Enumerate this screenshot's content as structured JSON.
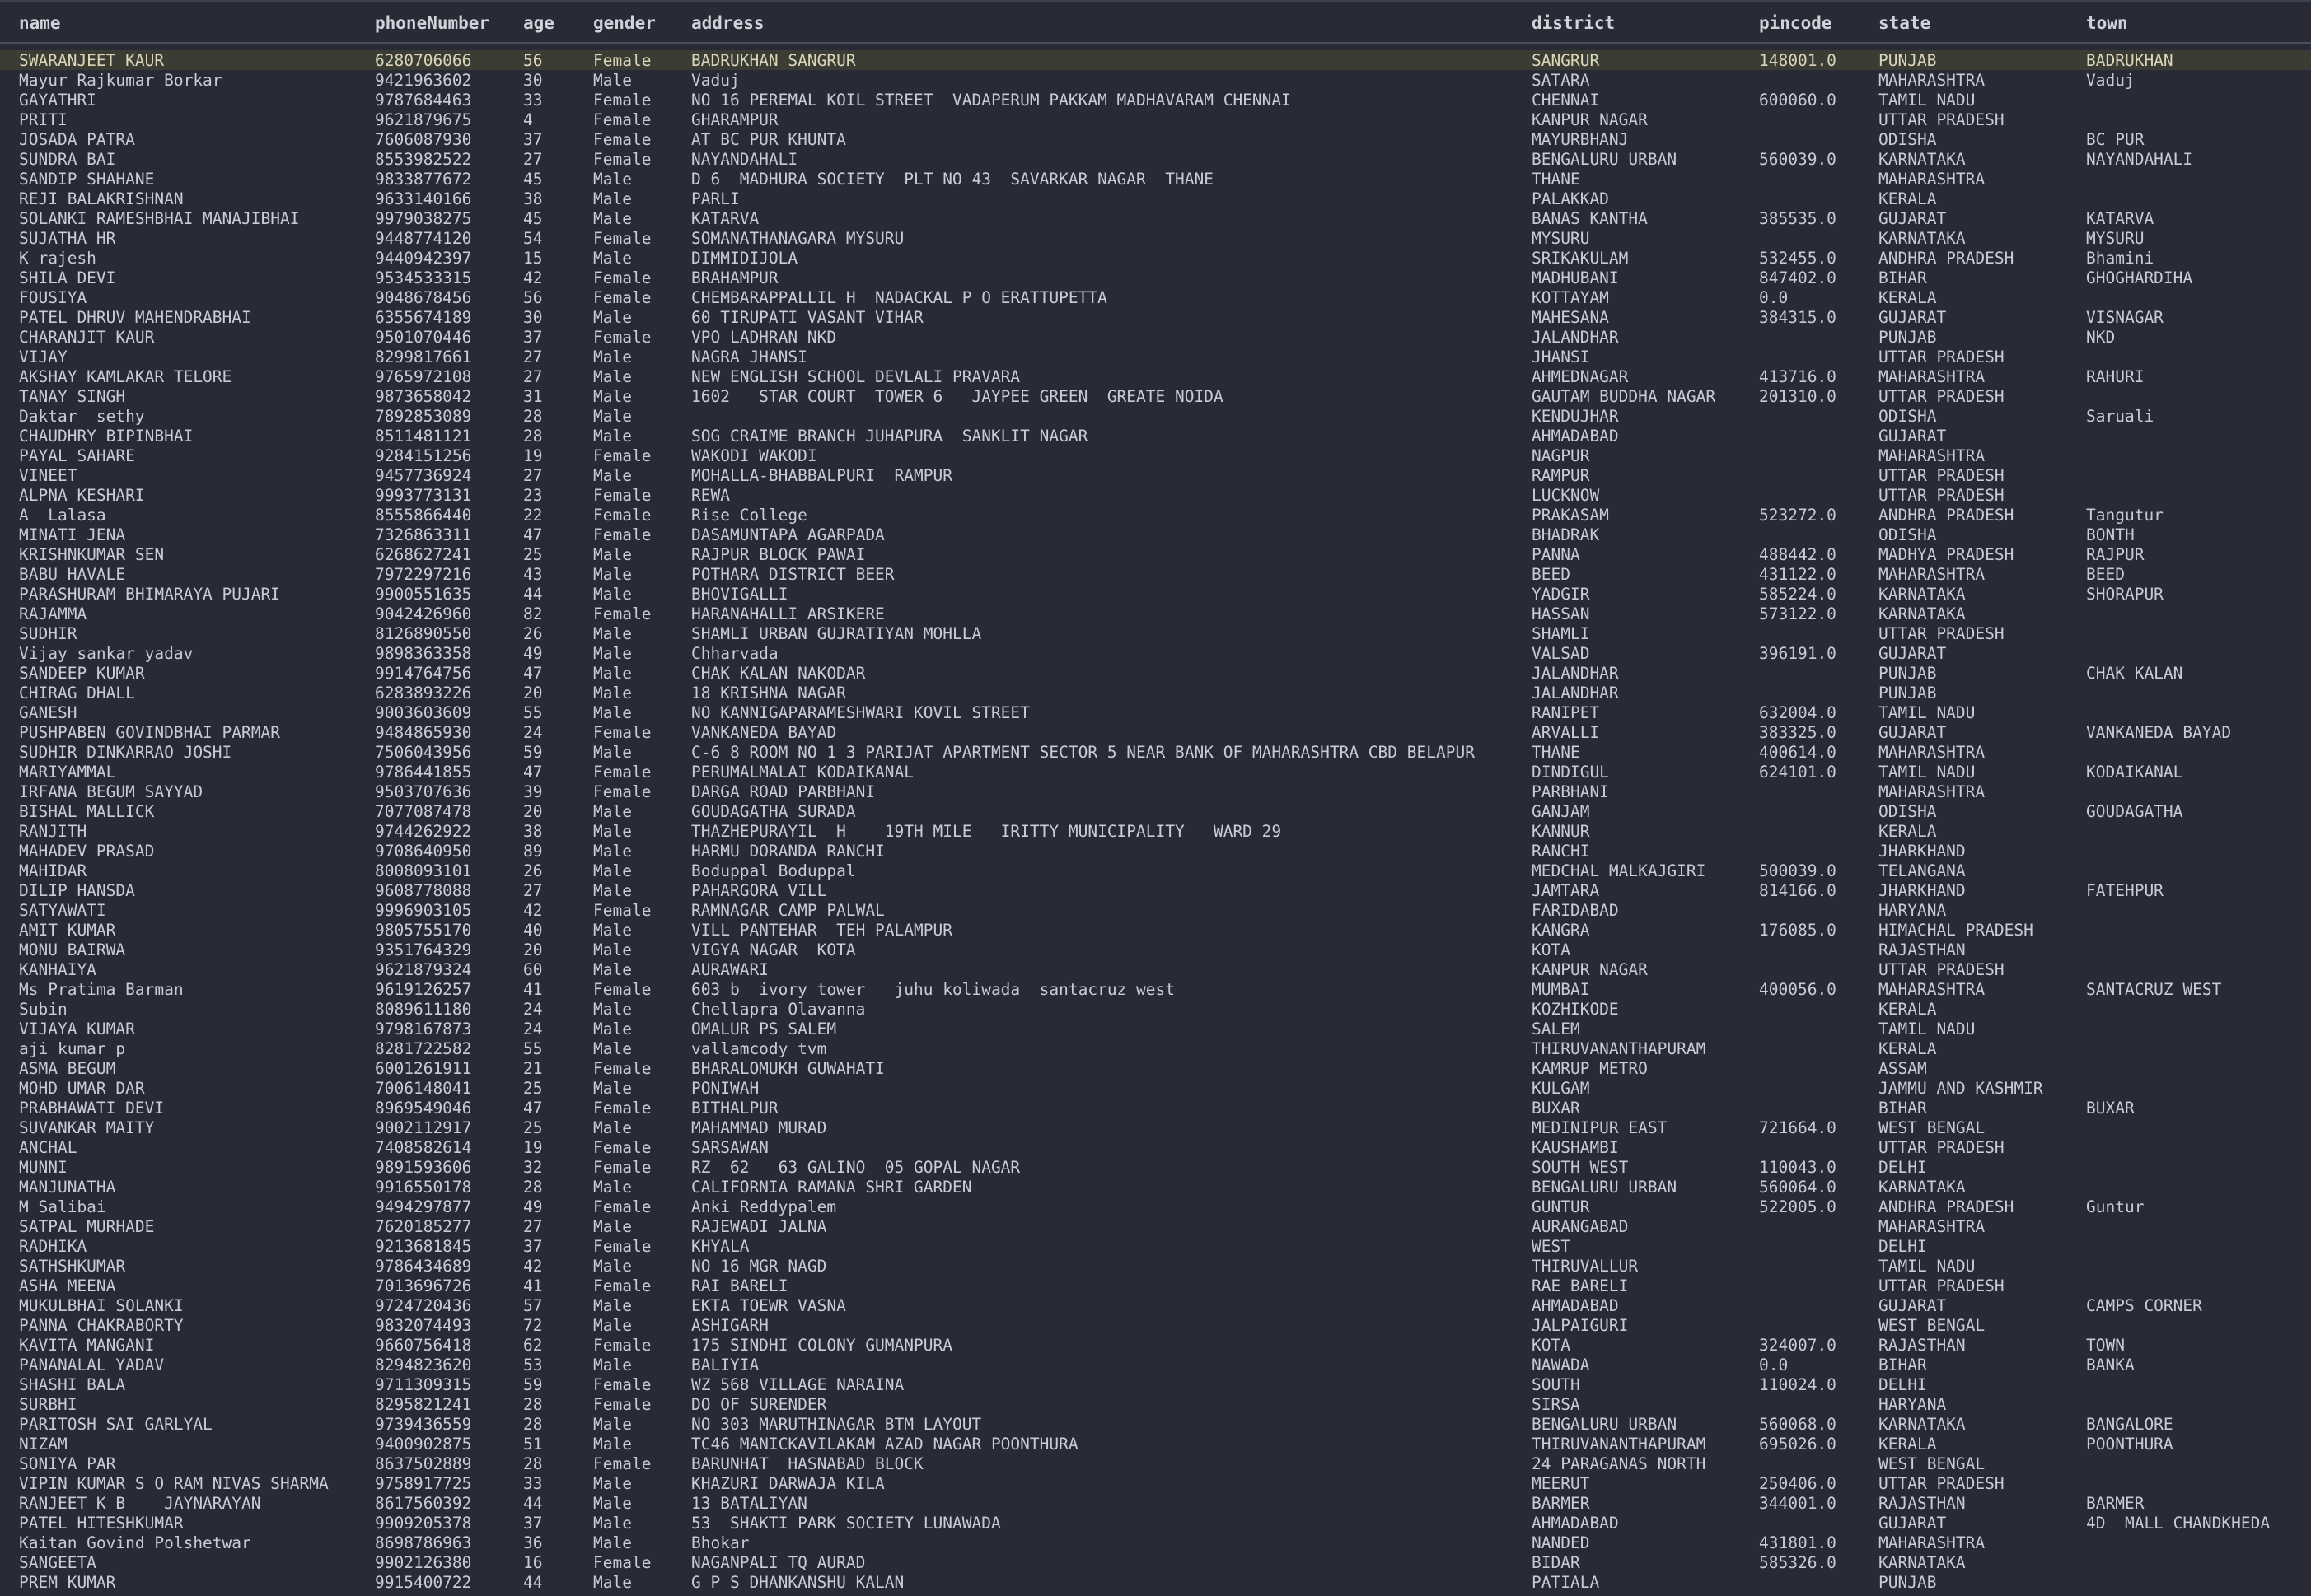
{
  "columns": [
    "name",
    "phoneNumber",
    "age",
    "gender",
    "address",
    "district",
    "pincode",
    "state",
    "town"
  ],
  "selected_row": 0,
  "rows": [
    [
      "SWARANJEET KAUR",
      "6280706066",
      "56",
      "Female",
      "BADRUKHAN SANGRUR",
      "SANGRUR",
      "148001.0",
      "PUNJAB",
      "BADRUKHAN"
    ],
    [
      "Mayur Rajkumar Borkar",
      "9421963602",
      "30",
      "Male",
      "Vaduj",
      "SATARA",
      "",
      "MAHARASHTRA",
      "Vaduj"
    ],
    [
      "GAYATHRI",
      "9787684463",
      "33",
      "Female",
      "NO 16 PEREMAL KOIL STREET  VADAPERUM PAKKAM MADHAVARAM CHENNAI",
      "CHENNAI",
      "600060.0",
      "TAMIL NADU",
      ""
    ],
    [
      "PRITI",
      "9621879675",
      "4",
      "Female",
      "GHARAMPUR",
      "KANPUR NAGAR",
      "",
      "UTTAR PRADESH",
      ""
    ],
    [
      "JOSADA PATRA",
      "7606087930",
      "37",
      "Female",
      "AT BC PUR KHUNTA",
      "MAYURBHANJ",
      "",
      "ODISHA",
      "BC PUR"
    ],
    [
      "SUNDRA BAI",
      "8553982522",
      "27",
      "Female",
      "NAYANDAHALI",
      "BENGALURU URBAN",
      "560039.0",
      "KARNATAKA",
      "NAYANDAHALI"
    ],
    [
      "SANDIP SHAHANE",
      "9833877672",
      "45",
      "Male",
      "D 6  MADHURA SOCIETY  PLT NO 43  SAVARKAR NAGAR  THANE",
      "THANE",
      "",
      "MAHARASHTRA",
      ""
    ],
    [
      "REJI BALAKRISHNAN",
      "9633140166",
      "38",
      "Male",
      "PARLI",
      "PALAKKAD",
      "",
      "KERALA",
      ""
    ],
    [
      "SOLANKI RAMESHBHAI MANAJIBHAI",
      "9979038275",
      "45",
      "Male",
      "KATARVA",
      "BANAS KANTHA",
      "385535.0",
      "GUJARAT",
      "KATARVA"
    ],
    [
      "SUJATHA HR",
      "9448774120",
      "54",
      "Female",
      "SOMANATHANAGARA MYSURU",
      "MYSURU",
      "",
      "KARNATAKA",
      "MYSURU"
    ],
    [
      "K rajesh",
      "9440942397",
      "15",
      "Male",
      "DIMMIDIJOLA",
      "SRIKAKULAM",
      "532455.0",
      "ANDHRA PRADESH",
      "Bhamini"
    ],
    [
      "SHILA DEVI",
      "9534533315",
      "42",
      "Female",
      "BRAHAMPUR",
      "MADHUBANI",
      "847402.0",
      "BIHAR",
      "GHOGHARDIHA"
    ],
    [
      "FOUSIYA",
      "9048678456",
      "56",
      "Female",
      "CHEMBARAPPALLIL H  NADACKAL P O ERATTUPETTA",
      "KOTTAYAM",
      "0.0",
      "KERALA",
      ""
    ],
    [
      "PATEL DHRUV MAHENDRABHAI",
      "6355674189",
      "30",
      "Male",
      "60 TIRUPATI VASANT VIHAR",
      "MAHESANA",
      "384315.0",
      "GUJARAT",
      "VISNAGAR"
    ],
    [
      "CHARANJIT KAUR",
      "9501070446",
      "37",
      "Female",
      "VPO LADHRAN NKD",
      "JALANDHAR",
      "",
      "PUNJAB",
      "NKD"
    ],
    [
      "VIJAY",
      "8299817661",
      "27",
      "Male",
      "NAGRA JHANSI",
      "JHANSI",
      "",
      "UTTAR PRADESH",
      ""
    ],
    [
      "AKSHAY KAMLAKAR TELORE",
      "9765972108",
      "27",
      "Male",
      "NEW ENGLISH SCHOOL DEVLALI PRAVARA",
      "AHMEDNAGAR",
      "413716.0",
      "MAHARASHTRA",
      "RAHURI"
    ],
    [
      "TANAY SINGH",
      "9873658042",
      "31",
      "Male",
      "1602   STAR COURT  TOWER 6   JAYPEE GREEN  GREATE NOIDA",
      "GAUTAM BUDDHA NAGAR",
      "201310.0",
      "UTTAR PRADESH",
      ""
    ],
    [
      "Daktar  sethy",
      "7892853089",
      "28",
      "Male",
      "",
      "KENDUJHAR",
      "",
      "ODISHA",
      "Saruali"
    ],
    [
      "CHAUDHRY BIPINBHAI",
      "8511481121",
      "28",
      "Male",
      "SOG CRAIME BRANCH JUHAPURA  SANKLIT NAGAR",
      "AHMADABAD",
      "",
      "GUJARAT",
      ""
    ],
    [
      "PAYAL SAHARE",
      "9284151256",
      "19",
      "Female",
      "WAKODI WAKODI",
      "NAGPUR",
      "",
      "MAHARASHTRA",
      ""
    ],
    [
      "VINEET",
      "9457736924",
      "27",
      "Male",
      "MOHALLA-BHABBALPURI  RAMPUR",
      "RAMPUR",
      "",
      "UTTAR PRADESH",
      ""
    ],
    [
      "ALPNA KESHARI",
      "9993773131",
      "23",
      "Female",
      "REWA",
      "LUCKNOW",
      "",
      "UTTAR PRADESH",
      ""
    ],
    [
      "A  Lalasa",
      "8555866440",
      "22",
      "Female",
      "Rise College",
      "PRAKASAM",
      "523272.0",
      "ANDHRA PRADESH",
      "Tangutur"
    ],
    [
      "MINATI JENA",
      "7326863311",
      "47",
      "Female",
      "DASAMUNTAPA AGARPADA",
      "BHADRAK",
      "",
      "ODISHA",
      "BONTH"
    ],
    [
      "KRISHNKUMAR SEN",
      "6268627241",
      "25",
      "Male",
      "RAJPUR BLOCK PAWAI",
      "PANNA",
      "488442.0",
      "MADHYA PRADESH",
      "RAJPUR"
    ],
    [
      "BABU HAVALE",
      "7972297216",
      "43",
      "Male",
      "POTHARA DISTRICT BEER",
      "BEED",
      "431122.0",
      "MAHARASHTRA",
      "BEED"
    ],
    [
      "PARASHURAM BHIMARAYA PUJARI",
      "9900551635",
      "44",
      "Male",
      "BHOVIGALLI",
      "YADGIR",
      "585224.0",
      "KARNATAKA",
      "SHORAPUR"
    ],
    [
      "RAJAMMA",
      "9042426960",
      "82",
      "Female",
      "HARANAHALLI ARSIKERE",
      "HASSAN",
      "573122.0",
      "KARNATAKA",
      ""
    ],
    [
      "SUDHIR",
      "8126890550",
      "26",
      "Male",
      "SHAMLI URBAN GUJRATIYAN MOHLLA",
      "SHAMLI",
      "",
      "UTTAR PRADESH",
      ""
    ],
    [
      "Vijay sankar yadav",
      "9898363358",
      "49",
      "Male",
      "Chharvada",
      "VALSAD",
      "396191.0",
      "GUJARAT",
      ""
    ],
    [
      "SANDEEP KUMAR",
      "9914764756",
      "47",
      "Male",
      "CHAK KALAN NAKODAR",
      "JALANDHAR",
      "",
      "PUNJAB",
      "CHAK KALAN"
    ],
    [
      "CHIRAG DHALL",
      "6283893226",
      "20",
      "Male",
      "18 KRISHNA NAGAR",
      "JALANDHAR",
      "",
      "PUNJAB",
      ""
    ],
    [
      "GANESH",
      "9003603609",
      "55",
      "Male",
      "NO KANNIGAPARAMESHWARI KOVIL STREET",
      "RANIPET",
      "632004.0",
      "TAMIL NADU",
      ""
    ],
    [
      "PUSHPABEN GOVINDBHAI PARMAR",
      "9484865930",
      "24",
      "Female",
      "VANKANEDA BAYAD",
      "ARVALLI",
      "383325.0",
      "GUJARAT",
      "VANKANEDA BAYAD"
    ],
    [
      "SUDHIR DINKARRAO JOSHI",
      "7506043956",
      "59",
      "Male",
      "C-6 8 ROOM NO 1 3 PARIJAT APARTMENT SECTOR 5 NEAR BANK OF MAHARASHTRA CBD BELAPUR",
      "THANE",
      "400614.0",
      "MAHARASHTRA",
      ""
    ],
    [
      "MARIYAMMAL",
      "9786441855",
      "47",
      "Female",
      "PERUMALMALAI KODAIKANAL",
      "DINDIGUL",
      "624101.0",
      "TAMIL NADU",
      "KODAIKANAL"
    ],
    [
      "IRFANA BEGUM SAYYAD",
      "9503707636",
      "39",
      "Female",
      "DARGA ROAD PARBHANI",
      "PARBHANI",
      "",
      "MAHARASHTRA",
      ""
    ],
    [
      "BISHAL MALLICK",
      "7077087478",
      "20",
      "Male",
      "GOUDAGATHA SURADA",
      "GANJAM",
      "",
      "ODISHA",
      "GOUDAGATHA"
    ],
    [
      "RANJITH",
      "9744262922",
      "38",
      "Male",
      "THAZHEPURAYIL  H    19TH MILE   IRITTY MUNICIPALITY   WARD 29",
      "KANNUR",
      "",
      "KERALA",
      ""
    ],
    [
      "MAHADEV PRASAD",
      "9708640950",
      "89",
      "Male",
      "HARMU DORANDA RANCHI",
      "RANCHI",
      "",
      "JHARKHAND",
      ""
    ],
    [
      "MAHIDAR",
      "8008093101",
      "26",
      "Male",
      "Boduppal Boduppal",
      "MEDCHAL MALKAJGIRI",
      "500039.0",
      "TELANGANA",
      ""
    ],
    [
      "DILIP HANSDA",
      "9608778088",
      "27",
      "Male",
      "PAHARGORA VILL",
      "JAMTARA",
      "814166.0",
      "JHARKHAND",
      "FATEHPUR"
    ],
    [
      "SATYAWATI",
      "9996903105",
      "42",
      "Female",
      "RAMNAGAR CAMP PALWAL",
      "FARIDABAD",
      "",
      "HARYANA",
      ""
    ],
    [
      "AMIT KUMAR",
      "9805755170",
      "40",
      "Male",
      "VILL PANTEHAR  TEH PALAMPUR",
      "KANGRA",
      "176085.0",
      "HIMACHAL PRADESH",
      ""
    ],
    [
      "MONU BAIRWA",
      "9351764329",
      "20",
      "Male",
      "VIGYA NAGAR  KOTA",
      "KOTA",
      "",
      "RAJASTHAN",
      ""
    ],
    [
      "KANHAIYA",
      "9621879324",
      "60",
      "Male",
      "AURAWARI",
      "KANPUR NAGAR",
      "",
      "UTTAR PRADESH",
      ""
    ],
    [
      "Ms Pratima Barman",
      "9619126257",
      "41",
      "Female",
      "603 b  ivory tower   juhu koliwada  santacruz west",
      "MUMBAI",
      "400056.0",
      "MAHARASHTRA",
      "SANTACRUZ WEST"
    ],
    [
      "Subin",
      "8089611180",
      "24",
      "Male",
      "Chellapra Olavanna",
      "KOZHIKODE",
      "",
      "KERALA",
      ""
    ],
    [
      "VIJAYA KUMAR",
      "9798167873",
      "24",
      "Male",
      "OMALUR PS SALEM",
      "SALEM",
      "",
      "TAMIL NADU",
      ""
    ],
    [
      "aji kumar p",
      "8281722582",
      "55",
      "Male",
      "vallamcody tvm",
      "THIRUVANANTHAPURAM",
      "",
      "KERALA",
      ""
    ],
    [
      "ASMA BEGUM",
      "6001261911",
      "21",
      "Female",
      "BHARALOMUKH GUWAHATI",
      "KAMRUP METRO",
      "",
      "ASSAM",
      ""
    ],
    [
      "MOHD UMAR DAR",
      "7006148041",
      "25",
      "Male",
      "PONIWAH",
      "KULGAM",
      "",
      "JAMMU AND KASHMIR",
      ""
    ],
    [
      "PRABHAWATI DEVI",
      "8969549046",
      "47",
      "Female",
      "BITHALPUR",
      "BUXAR",
      "",
      "BIHAR",
      "BUXAR"
    ],
    [
      "SUVANKAR MAITY",
      "9002112917",
      "25",
      "Male",
      "MAHAMMAD MURAD",
      "MEDINIPUR EAST",
      "721664.0",
      "WEST BENGAL",
      ""
    ],
    [
      "ANCHAL",
      "7408582614",
      "19",
      "Female",
      "SARSAWAN",
      "KAUSHAMBI",
      "",
      "UTTAR PRADESH",
      ""
    ],
    [
      "MUNNI",
      "9891593606",
      "32",
      "Female",
      "RZ  62   63 GALINO  05 GOPAL NAGAR",
      "SOUTH WEST",
      "110043.0",
      "DELHI",
      ""
    ],
    [
      "MANJUNATHA",
      "9916550178",
      "28",
      "Male",
      "CALIFORNIA RAMANA SHRI GARDEN",
      "BENGALURU URBAN",
      "560064.0",
      "KARNATAKA",
      ""
    ],
    [
      "M Salibai",
      "9494297877",
      "49",
      "Female",
      "Anki Reddypalem",
      "GUNTUR",
      "522005.0",
      "ANDHRA PRADESH",
      "Guntur"
    ],
    [
      "SATPAL MURHADE",
      "7620185277",
      "27",
      "Male",
      "RAJEWADI JALNA",
      "AURANGABAD",
      "",
      "MAHARASHTRA",
      ""
    ],
    [
      "RADHIKA",
      "9213681845",
      "37",
      "Female",
      "KHYALA",
      "WEST",
      "",
      "DELHI",
      ""
    ],
    [
      "SATHSHKUMAR",
      "9786434689",
      "42",
      "Male",
      "NO 16 MGR NAGD",
      "THIRUVALLUR",
      "",
      "TAMIL NADU",
      ""
    ],
    [
      "ASHA MEENA",
      "7013696726",
      "41",
      "Female",
      "RAI BARELI",
      "RAE BARELI",
      "",
      "UTTAR PRADESH",
      ""
    ],
    [
      "MUKULBHAI SOLANKI",
      "9724720436",
      "57",
      "Male",
      "EKTA TOEWR VASNA",
      "AHMADABAD",
      "",
      "GUJARAT",
      "CAMPS CORNER"
    ],
    [
      "PANNA CHAKRABORTY",
      "9832074493",
      "72",
      "Male",
      "ASHIGARH",
      "JALPAIGURI",
      "",
      "WEST BENGAL",
      ""
    ],
    [
      "KAVITA MANGANI",
      "9660756418",
      "62",
      "Female",
      "175 SINDHI COLONY GUMANPURA",
      "KOTA",
      "324007.0",
      "RAJASTHAN",
      "TOWN"
    ],
    [
      "PANANALAL YADAV",
      "8294823620",
      "53",
      "Male",
      "BALIYIA",
      "NAWADA",
      "0.0",
      "BIHAR",
      "BANKA"
    ],
    [
      "SHASHI BALA",
      "9711309315",
      "59",
      "Female",
      "WZ 568 VILLAGE NARAINA",
      "SOUTH",
      "110024.0",
      "DELHI",
      ""
    ],
    [
      "SURBHI",
      "8295821241",
      "28",
      "Female",
      "DO OF SURENDER",
      "SIRSA",
      "",
      "HARYANA",
      ""
    ],
    [
      "PARITOSH SAI GARLYAL",
      "9739436559",
      "28",
      "Male",
      "NO 303 MARUTHINAGAR BTM LAYOUT",
      "BENGALURU URBAN",
      "560068.0",
      "KARNATAKA",
      "BANGALORE"
    ],
    [
      "NIZAM",
      "9400902875",
      "51",
      "Male",
      "TC46 MANICKAVILAKAM AZAD NAGAR POONTHURA",
      "THIRUVANANTHAPURAM",
      "695026.0",
      "KERALA",
      "POONTHURA"
    ],
    [
      "SONIYA PAR",
      "8637502889",
      "28",
      "Female",
      "BARUNHAT  HASNABAD BLOCK",
      "24 PARAGANAS NORTH",
      "",
      "WEST BENGAL",
      ""
    ],
    [
      "VIPIN KUMAR S O RAM NIVAS SHARMA",
      "9758917725",
      "33",
      "Male",
      "KHAZURI DARWAJA KILA",
      "MEERUT",
      "250406.0",
      "UTTAR PRADESH",
      ""
    ],
    [
      "RANJEET K B    JAYNARAYAN",
      "8617560392",
      "44",
      "Male",
      "13 BATALIYAN",
      "BARMER",
      "344001.0",
      "RAJASTHAN",
      "BARMER"
    ],
    [
      "PATEL HITESHKUMAR",
      "9909205378",
      "37",
      "Male",
      "53  SHAKTI PARK SOCIETY LUNAWADA",
      "AHMADABAD",
      "",
      "GUJARAT",
      "4D  MALL CHANDKHEDA"
    ],
    [
      "Kaitan Govind Polshetwar",
      "8698786963",
      "36",
      "Male",
      "Bhokar",
      "NANDED",
      "431801.0",
      "MAHARASHTRA",
      ""
    ],
    [
      "SANGEETA",
      "9902126380",
      "16",
      "Female",
      "NAGANPALI TQ AURAD",
      "BIDAR",
      "585326.0",
      "KARNATAKA",
      ""
    ],
    [
      "PREM KUMAR",
      "9915400722",
      "44",
      "Male",
      "G P S DHANKANSHU KALAN",
      "PATIALA",
      "",
      "PUNJAB",
      ""
    ]
  ]
}
